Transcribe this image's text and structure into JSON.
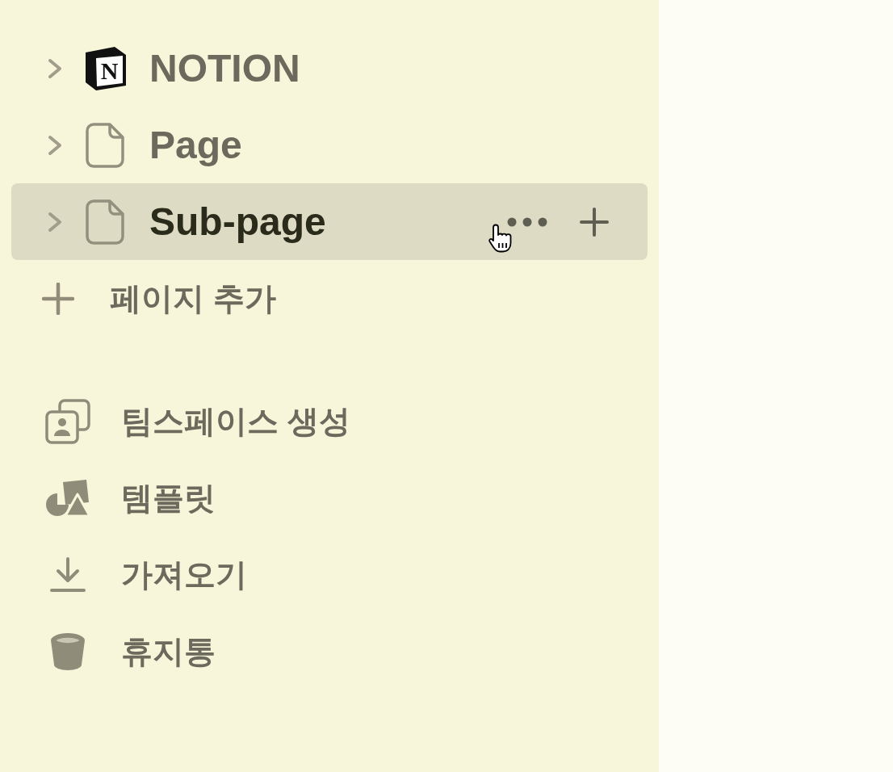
{
  "sidebar": {
    "pages": [
      {
        "kind": "workspace",
        "logo_letter": "N",
        "title": "NOTION",
        "expanded": false,
        "selected": false
      },
      {
        "kind": "page",
        "title": "Page",
        "expanded": false,
        "selected": false
      },
      {
        "kind": "page",
        "title": "Sub-page",
        "expanded": false,
        "selected": true
      }
    ],
    "add_page": {
      "label": "페이지 추가"
    },
    "items": [
      {
        "label": "팀스페이스 생성"
      },
      {
        "label": "템플릿"
      },
      {
        "label": "가져오기"
      },
      {
        "label": "휴지통"
      }
    ]
  }
}
